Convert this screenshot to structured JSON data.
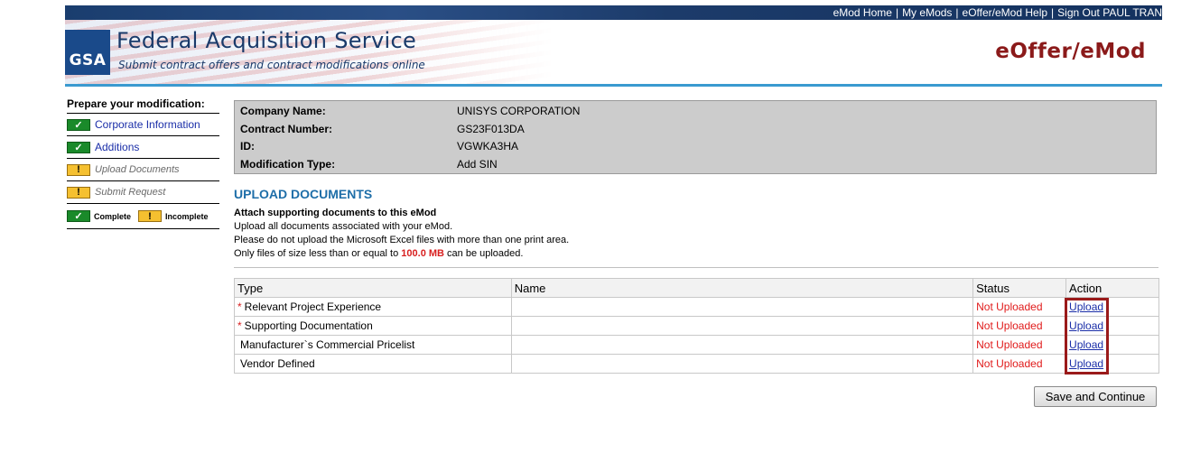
{
  "top_nav": {
    "links": [
      "eMod Home",
      "My eMods",
      "eOffer/eMod Help",
      "Sign Out PAUL TRAN"
    ],
    "separator": "|"
  },
  "header": {
    "logo_text": "GSA",
    "title": "Federal Acquisition Service",
    "subtitle": "Submit contract offers and contract modifications online",
    "app_title": "eOffer/eMod",
    "colors": {
      "title": "#1a3a6a",
      "app_title": "#8b1a1a",
      "rule": "#3a9ad0",
      "topbar": "#1a3d6e"
    }
  },
  "sidebar": {
    "title": "Prepare your modification:",
    "items": [
      {
        "label": "Corporate Information",
        "state": "complete",
        "icon": "checkmark-icon"
      },
      {
        "label": "Additions",
        "state": "complete",
        "icon": "checkmark-icon"
      },
      {
        "label": "Upload Documents",
        "state": "incomplete",
        "icon": "exclamation-icon"
      },
      {
        "label": "Submit Request",
        "state": "incomplete",
        "icon": "exclamation-icon"
      }
    ],
    "legend": {
      "complete_label": "Complete",
      "incomplete_label": "Incomplete"
    }
  },
  "contract_info": {
    "company_label": "Company Name:",
    "company_value": "UNISYS CORPORATION",
    "contract_label": "Contract Number:",
    "contract_value": "GS23F013DA",
    "id_label": "ID:",
    "id_value": "VGWKA3HA",
    "modtype_label": "Modification Type:",
    "modtype_value": "Add SIN"
  },
  "upload": {
    "title": "UPLOAD DOCUMENTS",
    "heading": "Attach supporting documents to this eMod",
    "line1": "Upload all documents associated with your eMod.",
    "line2": "Please do not upload the Microsoft Excel files with more than one print area.",
    "line3_prefix": "Only files of size less than or equal to",
    "max_size": "100.0 MB",
    "line3_suffix": "can be uploaded."
  },
  "documents_table": {
    "columns": [
      "Type",
      "Name",
      "Status",
      "Action"
    ],
    "rows": [
      {
        "required": "*",
        "type": "Relevant Project Experience",
        "name": "",
        "status": "Not Uploaded",
        "action": "Upload"
      },
      {
        "required": "*",
        "type": "Supporting Documentation",
        "name": "",
        "status": "Not Uploaded",
        "action": "Upload"
      },
      {
        "required": "",
        "type": "Manufacturer`s Commercial Pricelist",
        "name": "",
        "status": "Not Uploaded",
        "action": "Upload"
      },
      {
        "required": "",
        "type": "Vendor Defined",
        "name": "",
        "status": "Not Uploaded",
        "action": "Upload"
      }
    ]
  },
  "buttons": {
    "save_continue": "Save and Continue"
  }
}
